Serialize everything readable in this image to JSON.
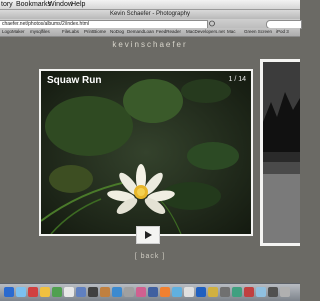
{
  "menubar": {
    "items": [
      "tory",
      "Bookmarks",
      "Window",
      "Help"
    ]
  },
  "window": {
    "title": "Kevin Schaefer - Photography"
  },
  "address": {
    "url": "chaefer.net/photos/albums/2/index.html"
  },
  "bookmarks": {
    "items": [
      "LogoMaker",
      "mysqlfiles",
      "FileLabs",
      "PrintBiome",
      "NoDog",
      "DemandLoan",
      "FeedReader",
      "MacDevelopers.net",
      "Mac",
      "Green Screen",
      "iPod 3"
    ]
  },
  "site": {
    "name": "kevinschaefer"
  },
  "slide": {
    "title": "Squaw Run",
    "counter": "1 / 14"
  },
  "controls": {
    "back_label": "[ back ]"
  },
  "colors": {
    "page_bg": "#6b6a65",
    "frame": "#f4f4f2"
  },
  "icons": [
    "apple-icon",
    "play-icon",
    "dock-app-icon"
  ]
}
